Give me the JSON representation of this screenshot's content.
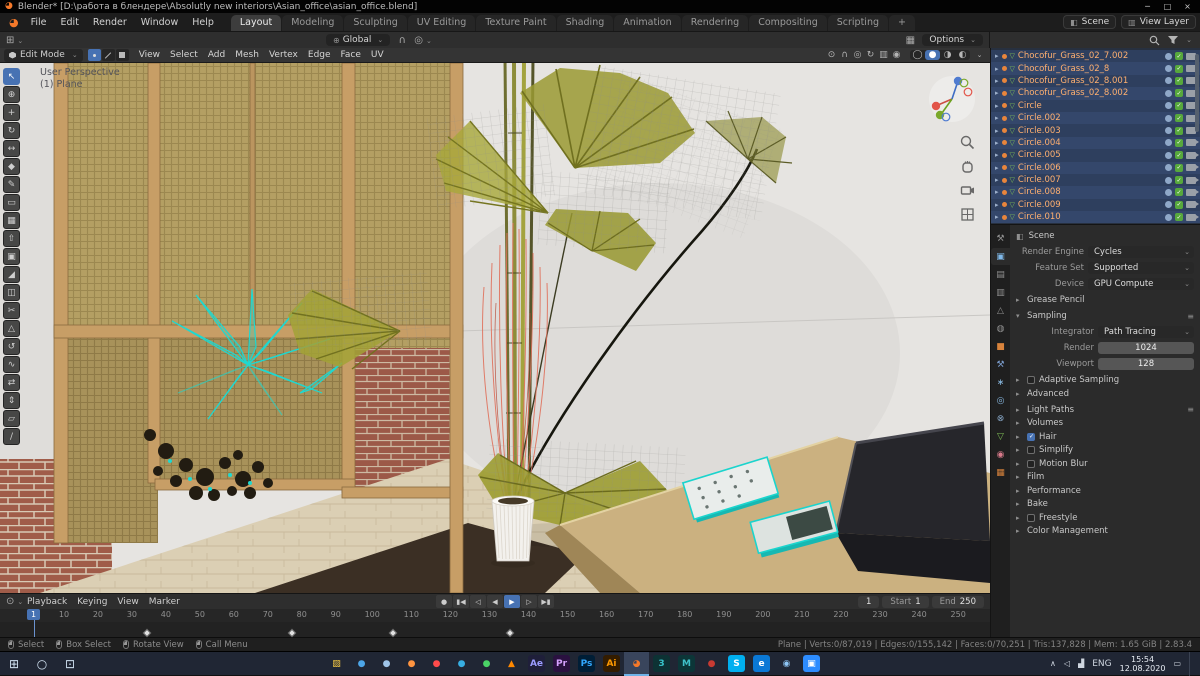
{
  "window": {
    "title": "Blender* [D:\\работа в блендере\\Absolutly new interiors\\Asian_office\\asian_office.blend]",
    "minimize": "─",
    "maximize": "□",
    "close": "×"
  },
  "menubar": {
    "menus": [
      {
        "label": "File"
      },
      {
        "label": "Edit"
      },
      {
        "label": "Render"
      },
      {
        "label": "Window"
      },
      {
        "label": "Help"
      }
    ],
    "tabs": [
      {
        "label": "Layout",
        "active": true
      },
      {
        "label": "Modeling"
      },
      {
        "label": "Sculpting"
      },
      {
        "label": "UV Editing"
      },
      {
        "label": "Texture Paint"
      },
      {
        "label": "Shading"
      },
      {
        "label": "Animation"
      },
      {
        "label": "Rendering"
      },
      {
        "label": "Compositing"
      },
      {
        "label": "Scripting"
      },
      {
        "label": "+"
      }
    ],
    "scene_selector": "Scene",
    "view_layer_selector": "View Layer"
  },
  "toolsettings": {
    "orientation": "Global",
    "options": "Options"
  },
  "viewport": {
    "mode": "Edit Mode",
    "menus": [
      {
        "label": "View"
      },
      {
        "label": "Select"
      },
      {
        "label": "Add"
      },
      {
        "label": "Mesh"
      },
      {
        "label": "Vertex"
      },
      {
        "label": "Edge"
      },
      {
        "label": "Face"
      },
      {
        "label": "UV"
      }
    ],
    "overlay_line1": "User Perspective",
    "overlay_line2": "(1) Plane",
    "header_icons": [
      {
        "name": "transform-pivot-icon",
        "glyph": "⊙"
      },
      {
        "name": "snap-magnet-icon",
        "glyph": "∩"
      },
      {
        "name": "proportional-edit-icon",
        "glyph": "◎"
      },
      {
        "name": "gizmos-icon",
        "glyph": "↻"
      },
      {
        "name": "overlays-icon",
        "glyph": "▥"
      },
      {
        "name": "xray-icon",
        "glyph": "◉"
      }
    ],
    "shading_modes": [
      {
        "name": "wireframe",
        "glyph": "◯"
      },
      {
        "name": "solid",
        "glyph": "●",
        "active": true
      },
      {
        "name": "material-preview",
        "glyph": "◑"
      },
      {
        "name": "rendered",
        "glyph": "◐"
      }
    ]
  },
  "tools": [
    {
      "name": "select-box",
      "glyph": "↖",
      "active": true
    },
    {
      "name": "cursor",
      "glyph": "⊕"
    },
    {
      "name": "move",
      "glyph": "+"
    },
    {
      "name": "rotate",
      "glyph": "↻"
    },
    {
      "name": "scale",
      "glyph": "↔"
    },
    {
      "name": "transform",
      "glyph": "◆"
    },
    {
      "name": "annotate",
      "glyph": "✎"
    },
    {
      "name": "measure",
      "glyph": "▭"
    },
    {
      "name": "add-cube",
      "glyph": "▦"
    },
    {
      "name": "extrude-region",
      "glyph": "⇧"
    },
    {
      "name": "inset-faces",
      "glyph": "▣"
    },
    {
      "name": "bevel",
      "glyph": "◢"
    },
    {
      "name": "loop-cut",
      "glyph": "◫"
    },
    {
      "name": "knife",
      "glyph": "✂"
    },
    {
      "name": "poly-build",
      "glyph": "△"
    },
    {
      "name": "spin",
      "glyph": "↺"
    },
    {
      "name": "smooth",
      "glyph": "∿"
    },
    {
      "name": "edge-slide",
      "glyph": "⇄"
    },
    {
      "name": "shrink-fatten",
      "glyph": "⇕"
    },
    {
      "name": "shear",
      "glyph": "▱"
    },
    {
      "name": "rip-region",
      "glyph": "/"
    }
  ],
  "outliner": {
    "items": [
      {
        "label": "Chocofur_Grass_02_7.002"
      },
      {
        "label": "Chocofur_Grass_02_8"
      },
      {
        "label": "Chocofur_Grass_02_8.001"
      },
      {
        "label": "Chocofur_Grass_02_8.002"
      },
      {
        "label": "Circle"
      },
      {
        "label": "Circle.002"
      },
      {
        "label": "Circle.003"
      },
      {
        "label": "Circle.004"
      },
      {
        "label": "Circle.005"
      },
      {
        "label": "Circle.006"
      },
      {
        "label": "Circle.007"
      },
      {
        "label": "Circle.008"
      },
      {
        "label": "Circle.009"
      },
      {
        "label": "Circle.010"
      }
    ]
  },
  "properties": {
    "breadcrumb": "Scene",
    "render_engine_label": "Render Engine",
    "render_engine": "Cycles",
    "feature_set_label": "Feature Set",
    "feature_set": "Supported",
    "device_label": "Device",
    "device": "GPU Compute",
    "grease_pencil": "Grease Pencil",
    "sampling_title": "Sampling",
    "integrator_label": "Integrator",
    "integrator": "Path Tracing",
    "render_label": "Render",
    "render_samples": "1024",
    "viewport_label": "Viewport",
    "viewport_samples": "128",
    "sampling_sub": [
      {
        "label": "Adaptive Sampling",
        "checkbox": true
      },
      {
        "label": "Advanced"
      }
    ],
    "sections": [
      {
        "label": "Light Paths",
        "menu": true
      },
      {
        "label": "Volumes"
      },
      {
        "label": "Hair",
        "checkbox": true,
        "checked": true
      },
      {
        "label": "Simplify",
        "checkbox": true
      },
      {
        "label": "Motion Blur",
        "checkbox": true
      },
      {
        "label": "Film"
      },
      {
        "label": "Performance"
      },
      {
        "label": "Bake"
      },
      {
        "label": "Freestyle",
        "checkbox": true
      },
      {
        "label": "Color Management"
      }
    ],
    "tab_icons": [
      {
        "name": "tool",
        "glyph": "⚒"
      },
      {
        "name": "render",
        "glyph": "▣",
        "active": true,
        "color": "#7fb8e8"
      },
      {
        "name": "output",
        "glyph": "▤"
      },
      {
        "name": "view-layer",
        "glyph": "▥"
      },
      {
        "name": "scene",
        "glyph": "△"
      },
      {
        "name": "world",
        "glyph": "◍"
      },
      {
        "name": "object",
        "glyph": "■",
        "color": "#d8833c"
      },
      {
        "name": "modifiers",
        "glyph": "⚒",
        "color": "#7a9ccc"
      },
      {
        "name": "particles",
        "glyph": "∗",
        "color": "#88b8e0"
      },
      {
        "name": "physics",
        "glyph": "◎",
        "color": "#88b8e0"
      },
      {
        "name": "constraints",
        "glyph": "⊗",
        "color": "#88a8c8"
      },
      {
        "name": "object-data",
        "glyph": "▽",
        "color": "#7fbf56"
      },
      {
        "name": "material",
        "glyph": "◉",
        "color": "#d87a8a"
      },
      {
        "name": "texture",
        "glyph": "▦",
        "color": "#d8833c"
      }
    ]
  },
  "timeline": {
    "menus": [
      {
        "label": "Playback"
      },
      {
        "label": "Keying"
      },
      {
        "label": "View"
      },
      {
        "label": "Marker"
      }
    ],
    "transport": [
      {
        "name": "record",
        "glyph": "●"
      },
      {
        "name": "jump-to-start",
        "glyph": "▮◀"
      },
      {
        "name": "previous-keyframe",
        "glyph": "◁"
      },
      {
        "name": "play-reverse",
        "glyph": "◀"
      },
      {
        "name": "play",
        "glyph": "▶",
        "active": true
      },
      {
        "name": "next-keyframe",
        "glyph": "▷"
      },
      {
        "name": "jump-to-end",
        "glyph": "▶▮"
      }
    ],
    "ruler": [
      {
        "label": "1"
      },
      {
        "label": "10"
      },
      {
        "label": "20"
      },
      {
        "label": "30"
      },
      {
        "label": "40"
      },
      {
        "label": "50"
      },
      {
        "label": "60"
      },
      {
        "label": "70"
      },
      {
        "label": "80"
      },
      {
        "label": "90"
      },
      {
        "label": "100"
      },
      {
        "label": "110"
      },
      {
        "label": "120"
      },
      {
        "label": "130"
      },
      {
        "label": "140"
      },
      {
        "label": "150"
      },
      {
        "label": "160"
      },
      {
        "label": "170"
      },
      {
        "label": "180"
      },
      {
        "label": "190"
      },
      {
        "label": "200"
      },
      {
        "label": "210"
      },
      {
        "label": "220"
      },
      {
        "label": "230"
      },
      {
        "label": "240"
      },
      {
        "label": "250"
      }
    ],
    "keyframes": [
      {
        "left": "14.5%"
      },
      {
        "left": "29.2%"
      },
      {
        "left": "39.4%"
      },
      {
        "left": "51.2%"
      }
    ],
    "playhead_frame": "1",
    "current_frame": "1",
    "start_label": "Start",
    "start_value": "1",
    "end_label": "End",
    "end_value": "250"
  },
  "statusbar": {
    "hints": [
      {
        "label": "Select"
      },
      {
        "label": "Box Select"
      },
      {
        "label": "Rotate View"
      },
      {
        "label": "Call Menu"
      }
    ],
    "stats": "Plane | Verts:0/87,019 | Edges:0/155,142 | Faces:0/70,251 | Tris:137,828 | Mem: 1.65 GiB | 2.83.4"
  },
  "taskbar": {
    "start_glyph": "⊞",
    "search_glyph": "○",
    "taskview_glyph": "⊡",
    "icons": [
      {
        "name": "file-explorer",
        "glyph": "▨",
        "fg": "#f6c944"
      },
      {
        "name": "browser-blue",
        "glyph": "●",
        "fg": "#4da6e8"
      },
      {
        "name": "mail",
        "glyph": "●",
        "fg": "#9fc4e8"
      },
      {
        "name": "firefox",
        "glyph": "●",
        "fg": "#ff9440"
      },
      {
        "name": "opera",
        "glyph": "●",
        "fg": "#ff4b4b"
      },
      {
        "name": "telegram",
        "glyph": "●",
        "fg": "#37aee2"
      },
      {
        "name": "messenger-green",
        "glyph": "●",
        "fg": "#4ad366"
      },
      {
        "name": "vlc",
        "glyph": "▲",
        "fg": "#ff8800"
      },
      {
        "name": "after-effects",
        "glyph": "Ae",
        "fg": "#9b9bff",
        "bg": "#1f1f3a"
      },
      {
        "name": "premiere",
        "glyph": "Pr",
        "fg": "#d6a2ff",
        "bg": "#2a1140"
      },
      {
        "name": "photoshop",
        "glyph": "Ps",
        "fg": "#31a8ff",
        "bg": "#001e36"
      },
      {
        "name": "illustrator",
        "glyph": "Ai",
        "fg": "#ff9a00",
        "bg": "#331c00"
      },
      {
        "name": "blender",
        "glyph": "◕",
        "fg": "#f5792a",
        "active": true
      },
      {
        "name": "3ds-max",
        "glyph": "3",
        "fg": "#36c3c8",
        "bg": "#0d3234"
      },
      {
        "name": "maya",
        "glyph": "M",
        "fg": "#3fc1c9",
        "bg": "#0c3638"
      },
      {
        "name": "substance",
        "glyph": "●",
        "fg": "#c83a32"
      },
      {
        "name": "skype",
        "glyph": "S",
        "fg": "#ffffff",
        "bg": "#00aff0"
      },
      {
        "name": "edge",
        "glyph": "e",
        "fg": "#ffffff",
        "bg": "#0a78d6"
      },
      {
        "name": "chrome",
        "glyph": "◉",
        "fg": "#8ec6f5"
      },
      {
        "name": "zoom",
        "glyph": "▣",
        "fg": "#ffffff",
        "bg": "#2d8cff"
      }
    ],
    "tray_icons": [
      {
        "name": "tray-expand-icon",
        "glyph": "∧"
      },
      {
        "name": "volume-icon",
        "glyph": "◁"
      },
      {
        "name": "network-icon",
        "glyph": "▟"
      }
    ],
    "lang": "ENG",
    "time": "15:54",
    "date": "12.08.2020",
    "notification_glyph": "▭"
  }
}
